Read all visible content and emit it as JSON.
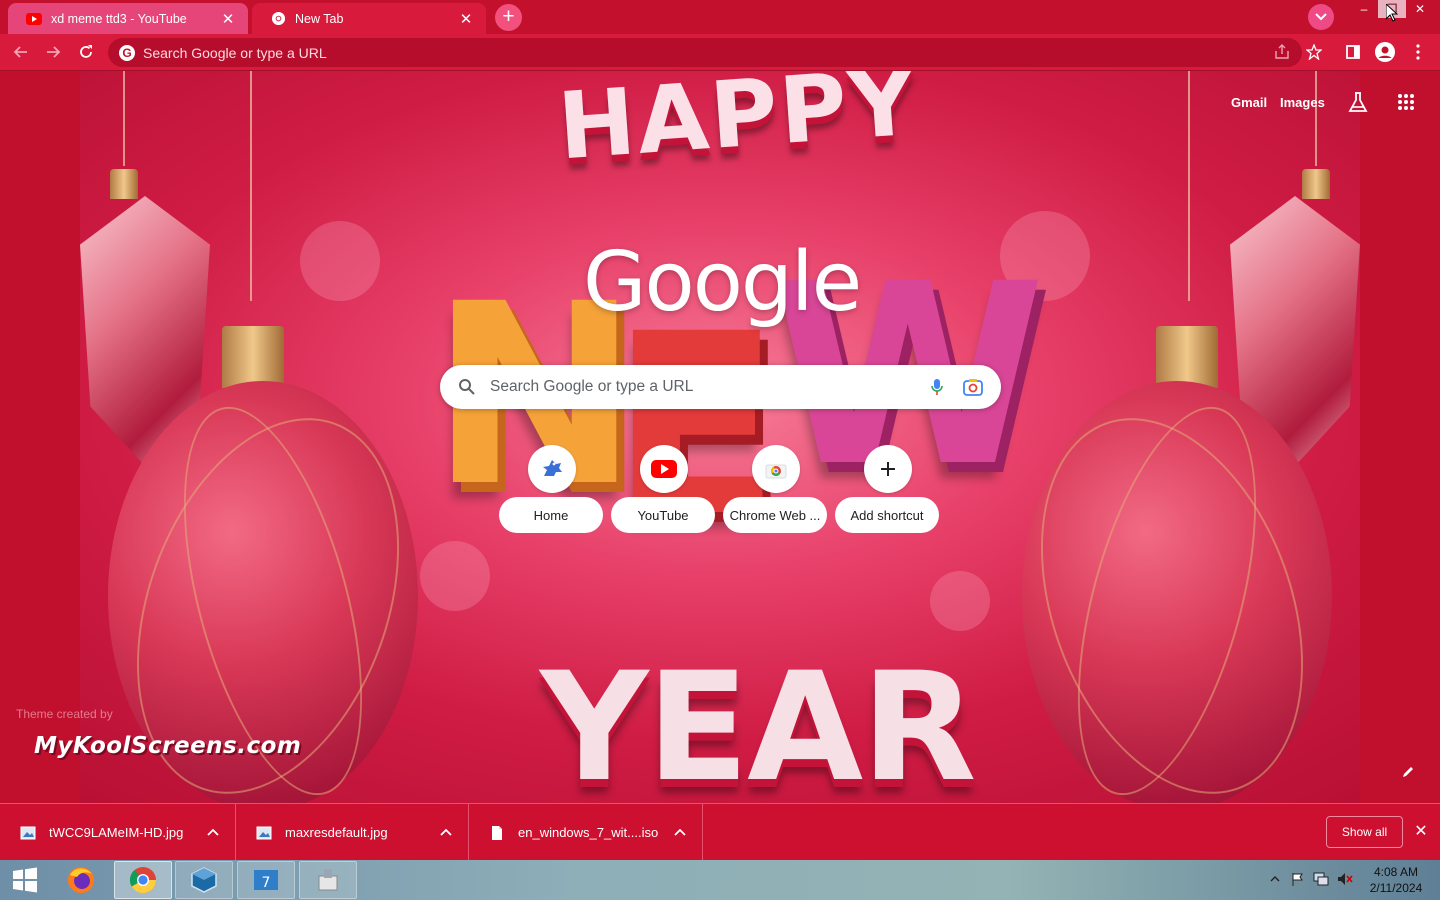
{
  "browser": {
    "tabs": [
      {
        "title": "xd meme ttd3 - YouTube",
        "favicon": "youtube-icon",
        "active": false
      },
      {
        "title": "New Tab",
        "favicon": "chrome-icon",
        "active": true
      }
    ],
    "new_tab_label": "+",
    "omnibox": {
      "placeholder": "Search Google or type a URL"
    }
  },
  "ntp": {
    "top_links": {
      "gmail": "Gmail",
      "images": "Images"
    },
    "google_logo": "Google",
    "search": {
      "placeholder": "Search Google or type a URL"
    },
    "shortcuts": [
      {
        "label": "Home",
        "icon": "dinosaur-icon"
      },
      {
        "label": "YouTube",
        "icon": "youtube-icon"
      },
      {
        "label": "Chrome Web ...",
        "icon": "chrome-web-store-icon"
      },
      {
        "label": "Add shortcut",
        "icon": "plus-icon"
      }
    ],
    "theme": {
      "created_by": "Theme created by",
      "author": "MyKoolScreens.com"
    },
    "background_text": {
      "happy": "HAPPY",
      "new_n": "N",
      "new_e": "E",
      "new_w": "W",
      "year": "YEAR"
    }
  },
  "downloads": {
    "items": [
      {
        "filename": "tWCC9LAMeIM-HD.jpg",
        "icon": "image-file-icon"
      },
      {
        "filename": "maxresdefault.jpg",
        "icon": "image-file-icon"
      },
      {
        "filename": "en_windows_7_wit....iso",
        "icon": "document-file-icon"
      }
    ],
    "show_all": "Show all"
  },
  "taskbar": {
    "apps": [
      "firefox-icon",
      "chrome-icon",
      "virtualbox-icon",
      "windows-7-usb-tool-icon",
      "installer-icon"
    ],
    "clock": {
      "time": "4:08 AM",
      "date": "2/11/2024"
    }
  },
  "colors": {
    "theme_red": "#c3102c",
    "toolbar_red": "#d81b3c",
    "tab_pink": "#e6457a"
  }
}
